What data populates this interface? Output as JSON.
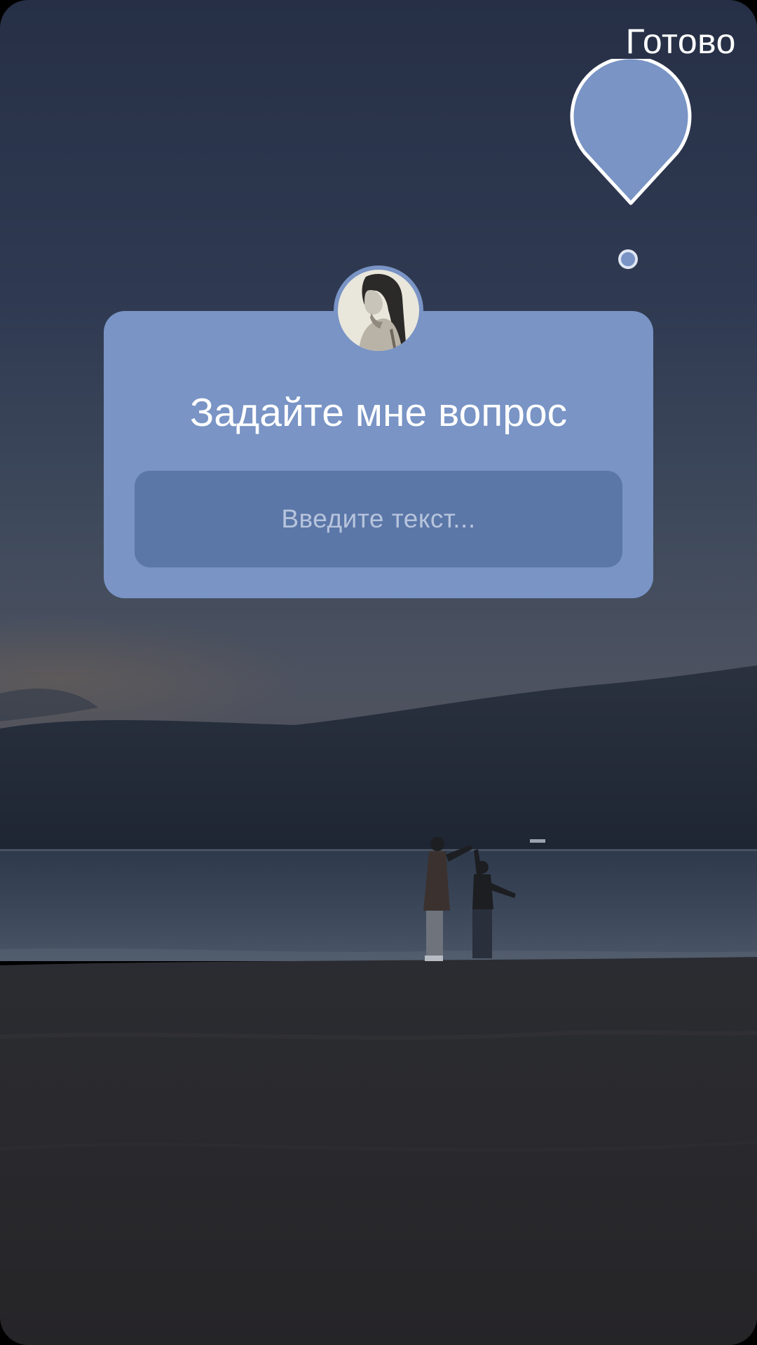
{
  "header": {
    "done_label": "Готово"
  },
  "question_sticker": {
    "title": "Задайте мне вопрос",
    "input_placeholder": "Введите текст...",
    "color": "#7994c5",
    "input_color": "#5b77a8"
  },
  "icons": {
    "color_picker": "color-drop-icon",
    "selected_color_dot": "color-dot-icon"
  }
}
